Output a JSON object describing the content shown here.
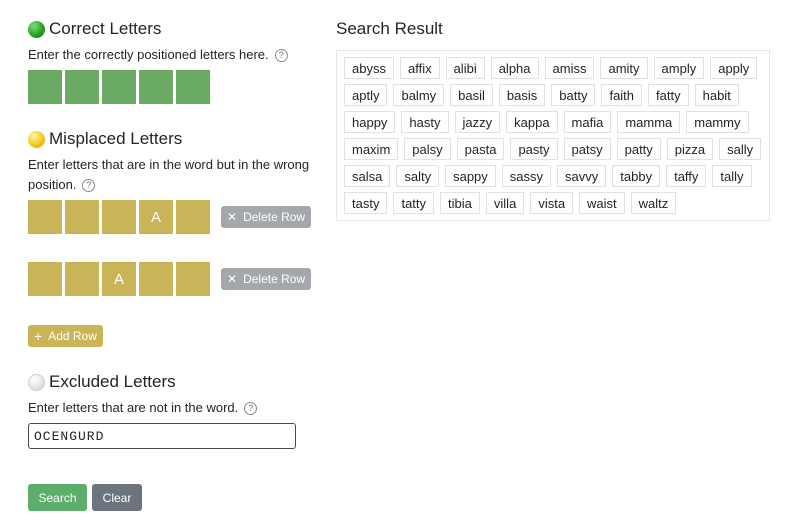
{
  "correct": {
    "title": "Correct Letters",
    "description": "Enter the correctly positioned letters here.",
    "tiles": [
      "",
      "",
      "",
      "",
      ""
    ]
  },
  "misplaced": {
    "title": "Misplaced Letters",
    "description_line1": "Enter letters that are in the word but in the wrong",
    "description_line2": "position.",
    "rows": [
      {
        "tiles": [
          "",
          "",
          "",
          "A",
          ""
        ],
        "delete_label": "Delete Row"
      },
      {
        "tiles": [
          "",
          "",
          "A",
          "",
          ""
        ],
        "delete_label": "Delete Row"
      }
    ],
    "add_label": "Add Row"
  },
  "excluded": {
    "title": "Excluded Letters",
    "description": "Enter letters that are not in the word.",
    "value": "OCENGURD"
  },
  "actions": {
    "search_label": "Search",
    "clear_label": "Clear"
  },
  "help_glyph": "?",
  "results": {
    "title": "Search Result",
    "words": [
      "abyss",
      "affix",
      "alibi",
      "alpha",
      "amiss",
      "amity",
      "amply",
      "apply",
      "aptly",
      "balmy",
      "basil",
      "basis",
      "batty",
      "faith",
      "fatty",
      "habit",
      "happy",
      "hasty",
      "jazzy",
      "kappa",
      "mafia",
      "mamma",
      "mammy",
      "maxim",
      "palsy",
      "pasta",
      "pasty",
      "patsy",
      "patty",
      "pizza",
      "sally",
      "salsa",
      "salty",
      "sappy",
      "sassy",
      "savvy",
      "tabby",
      "taffy",
      "tally",
      "tasty",
      "tatty",
      "tibia",
      "villa",
      "vista",
      "waist",
      "waltz"
    ]
  },
  "colors": {
    "green_tile": "#6aaa64",
    "yellow_tile": "#c9b458",
    "search_button": "#5cae6a",
    "clear_button": "#6c747d",
    "delete_button": "#a4a7ab"
  }
}
